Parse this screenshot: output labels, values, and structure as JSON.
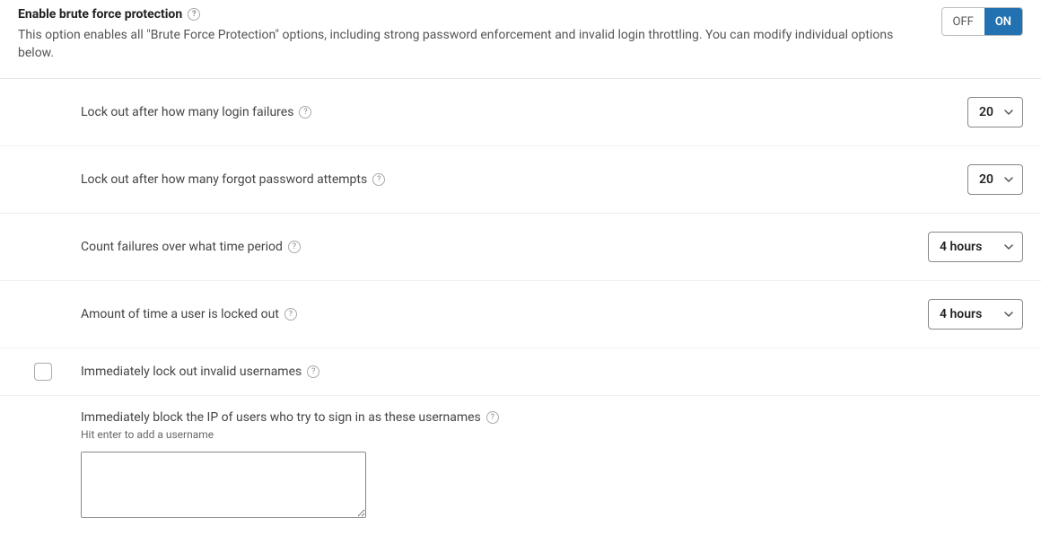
{
  "header": {
    "title": "Enable brute force protection",
    "description": "This option enables all \"Brute Force Protection\" options, including strong password enforcement and invalid login throttling. You can modify individual options below."
  },
  "toggle": {
    "off_label": "OFF",
    "on_label": "ON"
  },
  "settings": {
    "login_failures": {
      "label": "Lock out after how many login failures",
      "value": "20"
    },
    "forgot_attempts": {
      "label": "Lock out after how many forgot password attempts",
      "value": "20"
    },
    "time_period": {
      "label": "Count failures over what time period",
      "value": "4 hours"
    },
    "lockout_time": {
      "label": "Amount of time a user is locked out",
      "value": "4 hours"
    },
    "invalid_usernames": {
      "label": "Immediately lock out invalid usernames"
    },
    "block_ips": {
      "label": "Immediately block the IP of users who try to sign in as these usernames",
      "hint": "Hit enter to add a username"
    }
  },
  "help_symbol": "?"
}
